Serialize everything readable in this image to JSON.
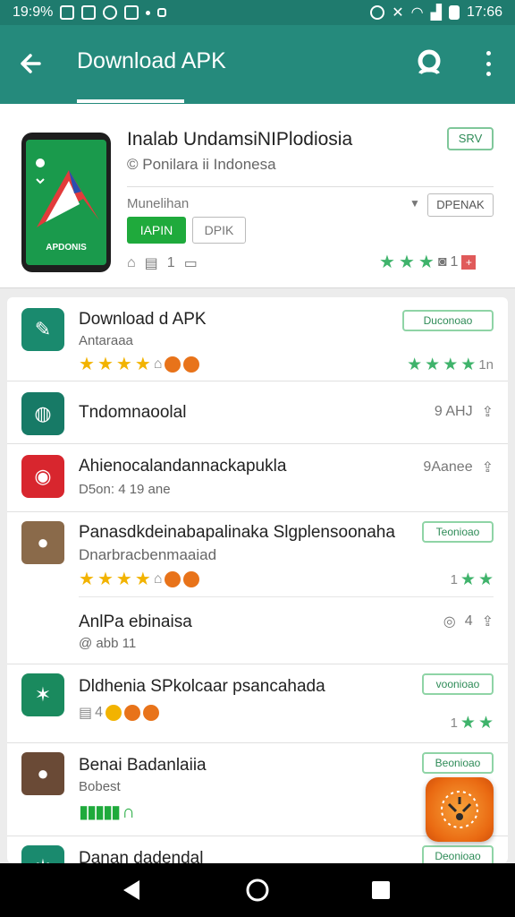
{
  "status": {
    "left_text": "19:9%",
    "right_text": "17:66"
  },
  "appbar": {
    "title": "Download APK"
  },
  "hero": {
    "phone_label": "APDONIS",
    "title": "Inalab UndamsiNIPlodiosia",
    "subtitle": "© Ponilara ii Indonesa",
    "meta": "Munelihan",
    "badge": "SRV",
    "open_button": "DPENAK",
    "chip_primary": "IAPIN",
    "chip_secondary": "DPIK",
    "icons_count": "1",
    "rating_count": "1"
  },
  "rows": [
    {
      "title": "Download d APK",
      "subtitle": "Antaraaa",
      "button": "Duconoao",
      "side_count": "1n"
    },
    {
      "title": "Tndomnaoolal",
      "actions": "9 AHJ"
    },
    {
      "title": "Ahienocalandannackapukla",
      "subtitle": "D5on: 4 19 ane",
      "actions": "9Aanee"
    },
    {
      "title": "Panasdkdeinabapalinaka Slgplensoonaha",
      "subtitle": "Dnarbracbenmaaiad",
      "button": "Teonioao",
      "side_count": "1"
    },
    {
      "title": "AnlPa ebinaisa",
      "subtitle": "@ abb 11",
      "actions": "4"
    },
    {
      "title": "Dldhenia SPkolcaar psancahada",
      "subtitle": "4",
      "button": "voonioao",
      "side_count": "1"
    },
    {
      "title": "Benai Badanlaiia",
      "subtitle": "Bobest",
      "button": "Beonioao"
    },
    {
      "title": "Danan dadendal",
      "button": "Deonioao"
    }
  ],
  "colors": {
    "primary": "#258a7c",
    "status": "#1f7b6e",
    "green": "#1faa3c",
    "star_yellow": "#f2b300",
    "star_green": "#3fb36b"
  }
}
